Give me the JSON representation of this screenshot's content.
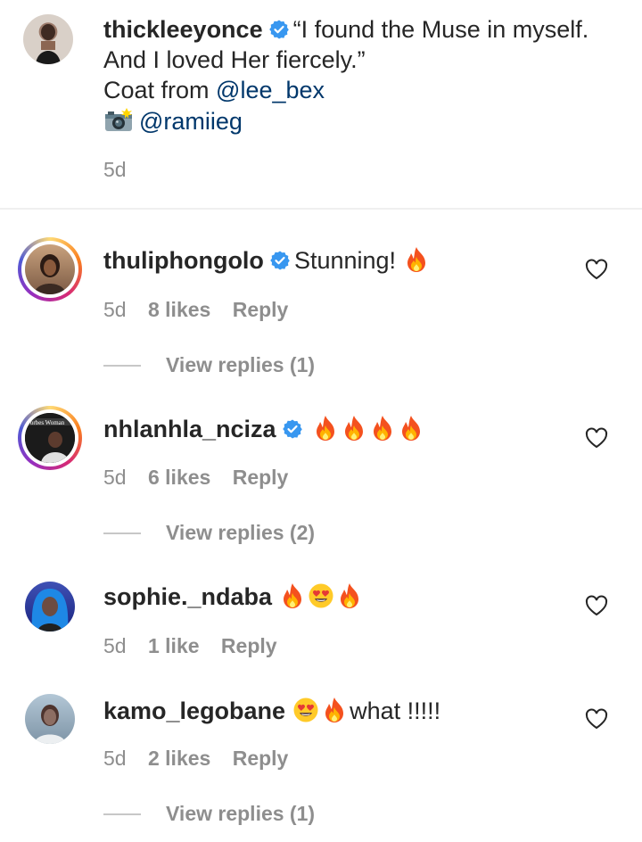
{
  "caption": {
    "username": "thickleeyonce",
    "line1": "“I found the Muse in myself.",
    "line2": "And I loved Her fiercely.”",
    "line3_prefix": "Coat from ",
    "line3_link": "@lee_bex",
    "line4_link": "@ramiieg",
    "camera_icon": "camera-flash-icon",
    "time": "5d"
  },
  "comments": [
    {
      "username": "thuliphongolo",
      "verified": true,
      "text": "Stunning! ",
      "emojis": [
        "fire"
      ],
      "time": "5d",
      "likes": "8 likes",
      "reply": "Reply",
      "view_replies": "View replies (1)"
    },
    {
      "username": "nhlanhla_nciza",
      "verified": true,
      "text": "",
      "emojis": [
        "fire",
        "fire",
        "fire",
        "fire"
      ],
      "time": "5d",
      "likes": "6 likes",
      "reply": "Reply",
      "view_replies": "View replies (2)",
      "avatar_text": "Forbes Woman"
    },
    {
      "username": "sophie._ndaba",
      "verified": false,
      "text": "",
      "emojis": [
        "fire",
        "heart-eyes",
        "fire"
      ],
      "time": "5d",
      "likes": "1 like",
      "reply": "Reply"
    },
    {
      "username": "kamo_legobane",
      "verified": false,
      "text": "what !!!!!",
      "emojis": [
        "heart-eyes",
        "fire"
      ],
      "time": "5d",
      "likes": "2 likes",
      "reply": "Reply",
      "view_replies": "View replies (1)"
    }
  ],
  "colors": {
    "text": "#262626",
    "muted": "#8e8e8e",
    "link": "#00376b",
    "verified": "#3897f0"
  }
}
